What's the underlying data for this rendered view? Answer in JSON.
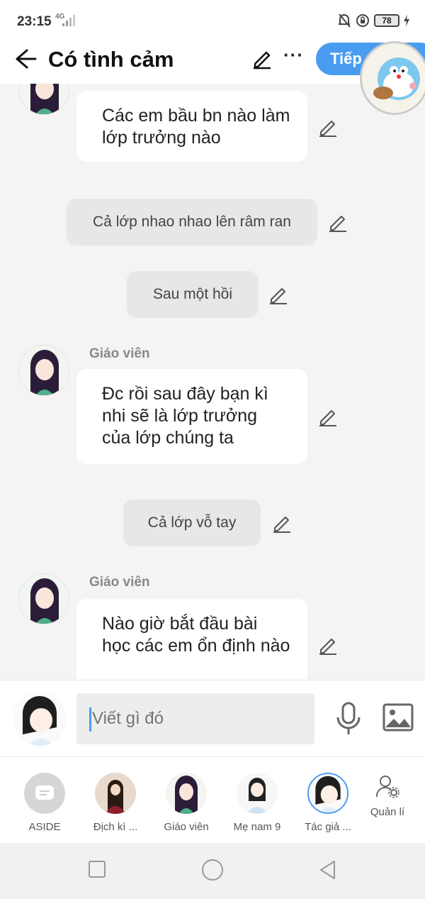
{
  "status_bar": {
    "time": "23:15",
    "network": "4G",
    "battery": "78"
  },
  "header": {
    "title": "Có tình cảm",
    "next_label": "Tiếp"
  },
  "chat": {
    "msg1": {
      "text": "Các em bầu bn nào làm lớp trưởng nào"
    },
    "narr1": {
      "text": "Cả lớp nhao nhao lên râm ran"
    },
    "narr2": {
      "text": "Sau một hồi"
    },
    "msg2": {
      "sender": "Giáo viên",
      "text": "Đc rồi sau đây bạn kì nhi sẽ là lớp trưởng của lớp chúng ta"
    },
    "narr3": {
      "text": "Cả lớp vỗ tay"
    },
    "msg3": {
      "sender": "Giáo viên",
      "text": "Nào giờ bắt đầu bài học các em ổn định nào"
    }
  },
  "input": {
    "placeholder": "Viết gì đó"
  },
  "characters": [
    {
      "label": "ASIDE"
    },
    {
      "label": "Địch kì ..."
    },
    {
      "label": "Giáo viên"
    },
    {
      "label": "Mẹ nam 9"
    },
    {
      "label": "Tác giả ..."
    }
  ],
  "manage_label": "Quản lí",
  "colors": {
    "accent": "#4a9cf0",
    "bubble": "#ffffff",
    "narration": "#e7e7e7",
    "background": "#f4f4f4"
  }
}
